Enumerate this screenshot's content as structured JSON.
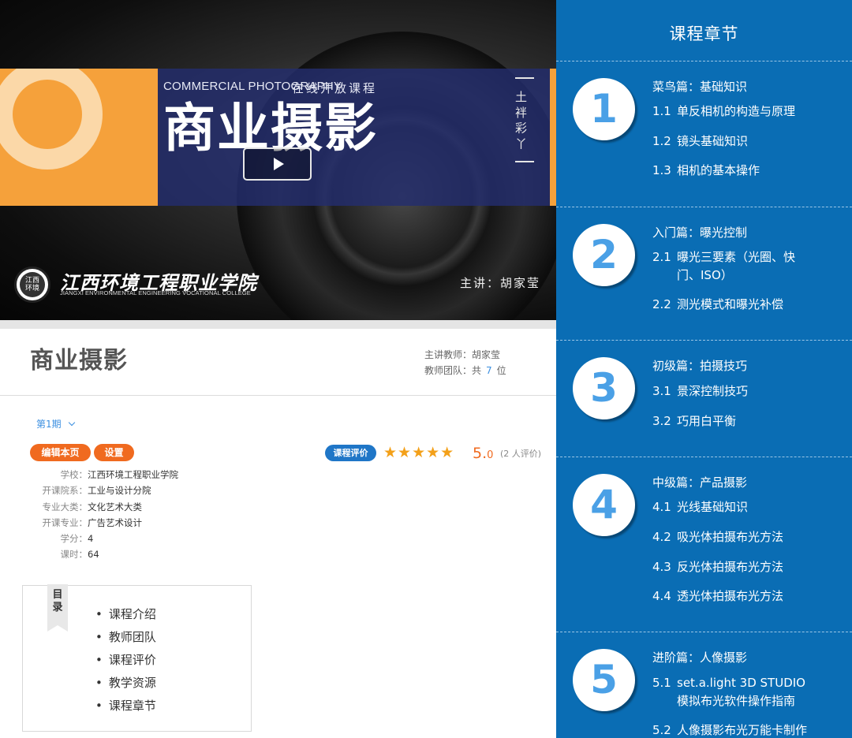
{
  "hero": {
    "en_title": "COMMERCIAL PHOTOGRAPHY",
    "cn_sub": "在线开放课程",
    "cn_title": "商业摄影",
    "calligraphy": "土 袢 彩 丫",
    "college_cn": "江西环境工程职业学院",
    "college_en": "JIANGXI ENVIRONMENTAL ENGINEERING VOCATIONAL COLLEGE",
    "lecturer": "主讲：胡家莹",
    "colors": {
      "orange": "#f5a13b",
      "banner_blue": "#232d6e"
    }
  },
  "course": {
    "title": "商业摄影",
    "main_teacher": "主讲教师：胡家莹",
    "team_prefix": "教师团队：共",
    "team_count": "7",
    "team_suffix": "位",
    "term": "第1期"
  },
  "actions": {
    "edit_label": "编辑本页",
    "settings_label": "设置"
  },
  "rating": {
    "badge_label": "课程评价",
    "stars_filled": 5,
    "stars_max": 5,
    "stars_text": "★★★★★",
    "score_int": "5.",
    "score_dec": "0",
    "count_text": "(2 人评价)"
  },
  "info": [
    {
      "key": "学校",
      "value": "江西环境工程职业学院"
    },
    {
      "key": "开课院系",
      "value": "工业与设计分院"
    },
    {
      "key": "专业大类",
      "value": "文化艺术大类"
    },
    {
      "key": "开课专业",
      "value": "广告艺术设计"
    },
    {
      "key": "学分",
      "value": "4"
    },
    {
      "key": "课时",
      "value": "64"
    }
  ],
  "toc": {
    "tag": "目录",
    "items": [
      "课程介绍",
      "教师团队",
      "课程评价",
      "教学资源",
      "课程章节"
    ]
  },
  "chapters_panel": {
    "title": "课程章节",
    "accent_color": "#0a6db4",
    "chapters": [
      {
        "num": "1",
        "title": "菜鸟篇：基础知识",
        "items": [
          {
            "n": "1.1",
            "t": "单反相机的构造与原理"
          },
          {
            "n": "1.2",
            "t": "镜头基础知识"
          },
          {
            "n": "1.3",
            "t": "相机的基本操作"
          }
        ]
      },
      {
        "num": "2",
        "title": "入门篇：曝光控制",
        "items": [
          {
            "n": "2.1",
            "t": "曝光三要素（光圈、快门、ISO）"
          },
          {
            "n": "2.2",
            "t": "测光模式和曝光补偿"
          }
        ]
      },
      {
        "num": "3",
        "title": "初级篇：拍摄技巧",
        "items": [
          {
            "n": "3.1",
            "t": "景深控制技巧"
          },
          {
            "n": "3.2",
            "t": "巧用白平衡"
          }
        ]
      },
      {
        "num": "4",
        "title": "中级篇：产品摄影",
        "items": [
          {
            "n": "4.1",
            "t": "光线基础知识"
          },
          {
            "n": "4.2",
            "t": "吸光体拍摄布光方法"
          },
          {
            "n": "4.3",
            "t": "反光体拍摄布光方法"
          },
          {
            "n": "4.4",
            "t": "透光体拍摄布光方法"
          }
        ]
      },
      {
        "num": "5",
        "title": "进阶篇：人像摄影",
        "items": [
          {
            "n": "5.1",
            "t": "set.a.light 3D STUDIO 模拟布光软件操作指南"
          },
          {
            "n": "5.2",
            "t": "人像摄影布光万能卡制作"
          }
        ]
      }
    ]
  }
}
